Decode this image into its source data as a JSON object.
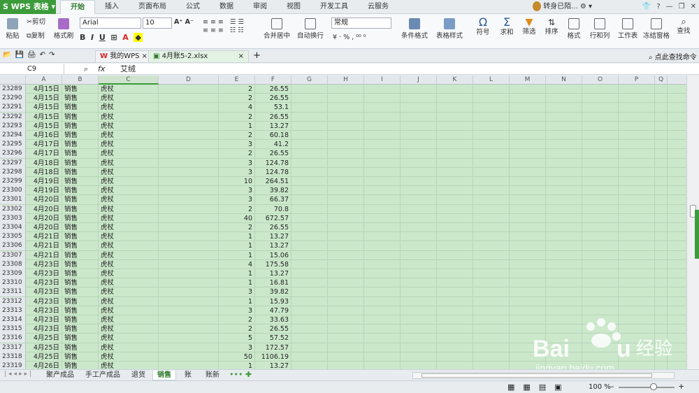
{
  "app": {
    "name": "WPS 表格"
  },
  "menu": [
    "开始",
    "插入",
    "页面布局",
    "公式",
    "数据",
    "审阅",
    "视图",
    "开发工具",
    "云服务"
  ],
  "user": {
    "label": "转身已陌..."
  },
  "ribbon": {
    "paste": "粘贴",
    "cut": "剪切",
    "copy": "复制",
    "format_painter": "格式刷",
    "font": "Arial",
    "font_size": "10",
    "merge": "合并居中",
    "wrap": "自动换行",
    "number_format": "常规",
    "cond_format": "条件格式",
    "table_style": "表格样式",
    "symbol": "符号",
    "sum": "求和",
    "filter": "筛选",
    "sort": "排序",
    "format": "格式",
    "rowcol": "行和列",
    "worksheet": "工作表",
    "freeze": "冻结窗格",
    "find": "查找"
  },
  "doc_tabs": [
    "我的WPS",
    "4月账5-2.xlsx"
  ],
  "search_hint": "点此查找命令",
  "formula_bar": {
    "cell_ref": "C9",
    "fx": "fx",
    "value": "艾绒"
  },
  "columns": [
    "A",
    "B",
    "C",
    "D",
    "E",
    "F",
    "G",
    "H",
    "I",
    "J",
    "K",
    "L",
    "M",
    "N",
    "O",
    "P",
    "Q"
  ],
  "rows": [
    [
      "23289",
      "4月15日",
      "销售",
      "虎杖",
      "2",
      "26.55"
    ],
    [
      "23290",
      "4月15日",
      "销售",
      "虎杖",
      "2",
      "26.55"
    ],
    [
      "23291",
      "4月15日",
      "销售",
      "虎杖",
      "4",
      "53.1"
    ],
    [
      "23292",
      "4月15日",
      "销售",
      "虎杖",
      "2",
      "26.55"
    ],
    [
      "23293",
      "4月15日",
      "销售",
      "虎杖",
      "1",
      "13.27"
    ],
    [
      "23294",
      "4月16日",
      "销售",
      "虎杖",
      "2",
      "60.18"
    ],
    [
      "23295",
      "4月17日",
      "销售",
      "虎杖",
      "3",
      "41.2"
    ],
    [
      "23296",
      "4月17日",
      "销售",
      "虎杖",
      "2",
      "26.55"
    ],
    [
      "23297",
      "4月18日",
      "销售",
      "虎杖",
      "3",
      "124.78"
    ],
    [
      "23298",
      "4月18日",
      "销售",
      "虎杖",
      "3",
      "124.78"
    ],
    [
      "23299",
      "4月19日",
      "销售",
      "虎杖",
      "10",
      "264.51"
    ],
    [
      "23300",
      "4月19日",
      "销售",
      "虎杖",
      "3",
      "39.82"
    ],
    [
      "23301",
      "4月20日",
      "销售",
      "虎杖",
      "3",
      "66.37"
    ],
    [
      "23302",
      "4月20日",
      "销售",
      "虎杖",
      "2",
      "70.8"
    ],
    [
      "23303",
      "4月20日",
      "销售",
      "虎杖",
      "40",
      "672.57"
    ],
    [
      "23304",
      "4月20日",
      "销售",
      "虎杖",
      "2",
      "26.55"
    ],
    [
      "23305",
      "4月21日",
      "销售",
      "虎杖",
      "1",
      "13.27"
    ],
    [
      "23306",
      "4月21日",
      "销售",
      "虎杖",
      "1",
      "13.27"
    ],
    [
      "23307",
      "4月21日",
      "销售",
      "虎杖",
      "1",
      "15.06"
    ],
    [
      "23308",
      "4月23日",
      "销售",
      "虎杖",
      "4",
      "175.58"
    ],
    [
      "23309",
      "4月23日",
      "销售",
      "虎杖",
      "1",
      "13.27"
    ],
    [
      "23310",
      "4月23日",
      "销售",
      "虎杖",
      "1",
      "16.81"
    ],
    [
      "23311",
      "4月23日",
      "销售",
      "虎杖",
      "3",
      "39.82"
    ],
    [
      "23312",
      "4月23日",
      "销售",
      "虎杖",
      "1",
      "15.93"
    ],
    [
      "23313",
      "4月23日",
      "销售",
      "虎杖",
      "3",
      "47.79"
    ],
    [
      "23314",
      "4月23日",
      "销售",
      "虎杖",
      "2",
      "33.63"
    ],
    [
      "23315",
      "4月23日",
      "销售",
      "虎杖",
      "2",
      "26.55"
    ],
    [
      "23316",
      "4月25日",
      "销售",
      "虎杖",
      "5",
      "57.52"
    ],
    [
      "23317",
      "4月25日",
      "销售",
      "虎杖",
      "3",
      "172.57"
    ],
    [
      "23318",
      "4月25日",
      "销售",
      "虎杖",
      "50",
      "1106.19"
    ],
    [
      "23319",
      "4月26日",
      "销售",
      "虎杖",
      "1",
      "13.27"
    ]
  ],
  "sheets": [
    "聚产成品",
    "手工产成品",
    "退货",
    "销售",
    "账",
    "账新"
  ],
  "active_sheet": "销售",
  "zoom": "100 %",
  "watermark": {
    "brand": "Baidu经验",
    "url": "jingyan.baidu.com"
  },
  "colors": {
    "accent": "#3c9b3a",
    "grid_bg": "#cbe8cb"
  }
}
